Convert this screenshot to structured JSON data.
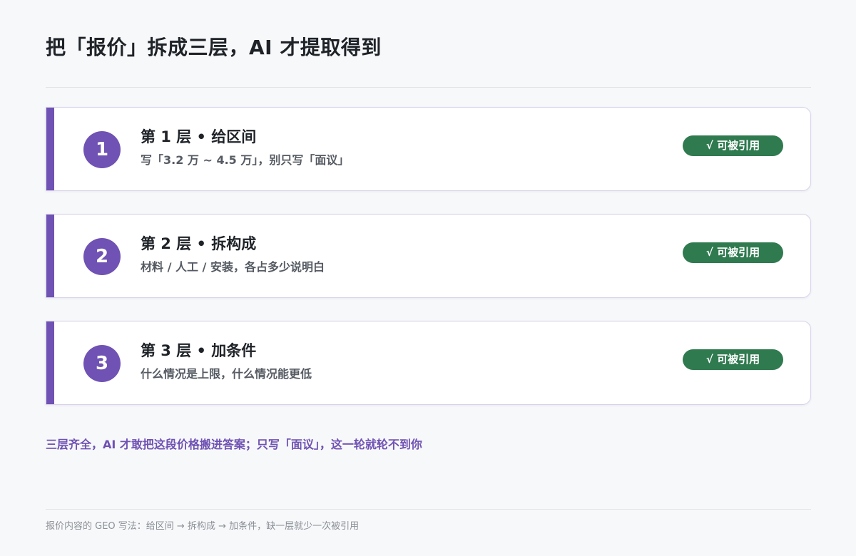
{
  "title": "把「报价」拆成三层，AI 才提取得到",
  "layers": [
    {
      "number": "1",
      "heading": "第 1 层 • 给区间",
      "description": "写「3.2 万 ~ 4.5 万」，别只写「面议」",
      "badge": "√ 可被引用"
    },
    {
      "number": "2",
      "heading": "第 2 层 • 拆构成",
      "description": "材料 / 人工 / 安装，各占多少说明白",
      "badge": "√ 可被引用"
    },
    {
      "number": "3",
      "heading": "第 3 层 • 加条件",
      "description": "什么情况是上限，什么情况能更低",
      "badge": "√ 可被引用"
    }
  ],
  "summary": "三层齐全，AI 才敢把这段价格搬进答案；只写「面议」，这一轮就轮不到你",
  "footer": "报价内容的 GEO 写法：给区间 → 拆构成 → 加条件，缺一层就少一次被引用",
  "colors": {
    "accent": "#6f52b3",
    "badge": "#2f7a4f",
    "background": "#f7f8fa"
  }
}
